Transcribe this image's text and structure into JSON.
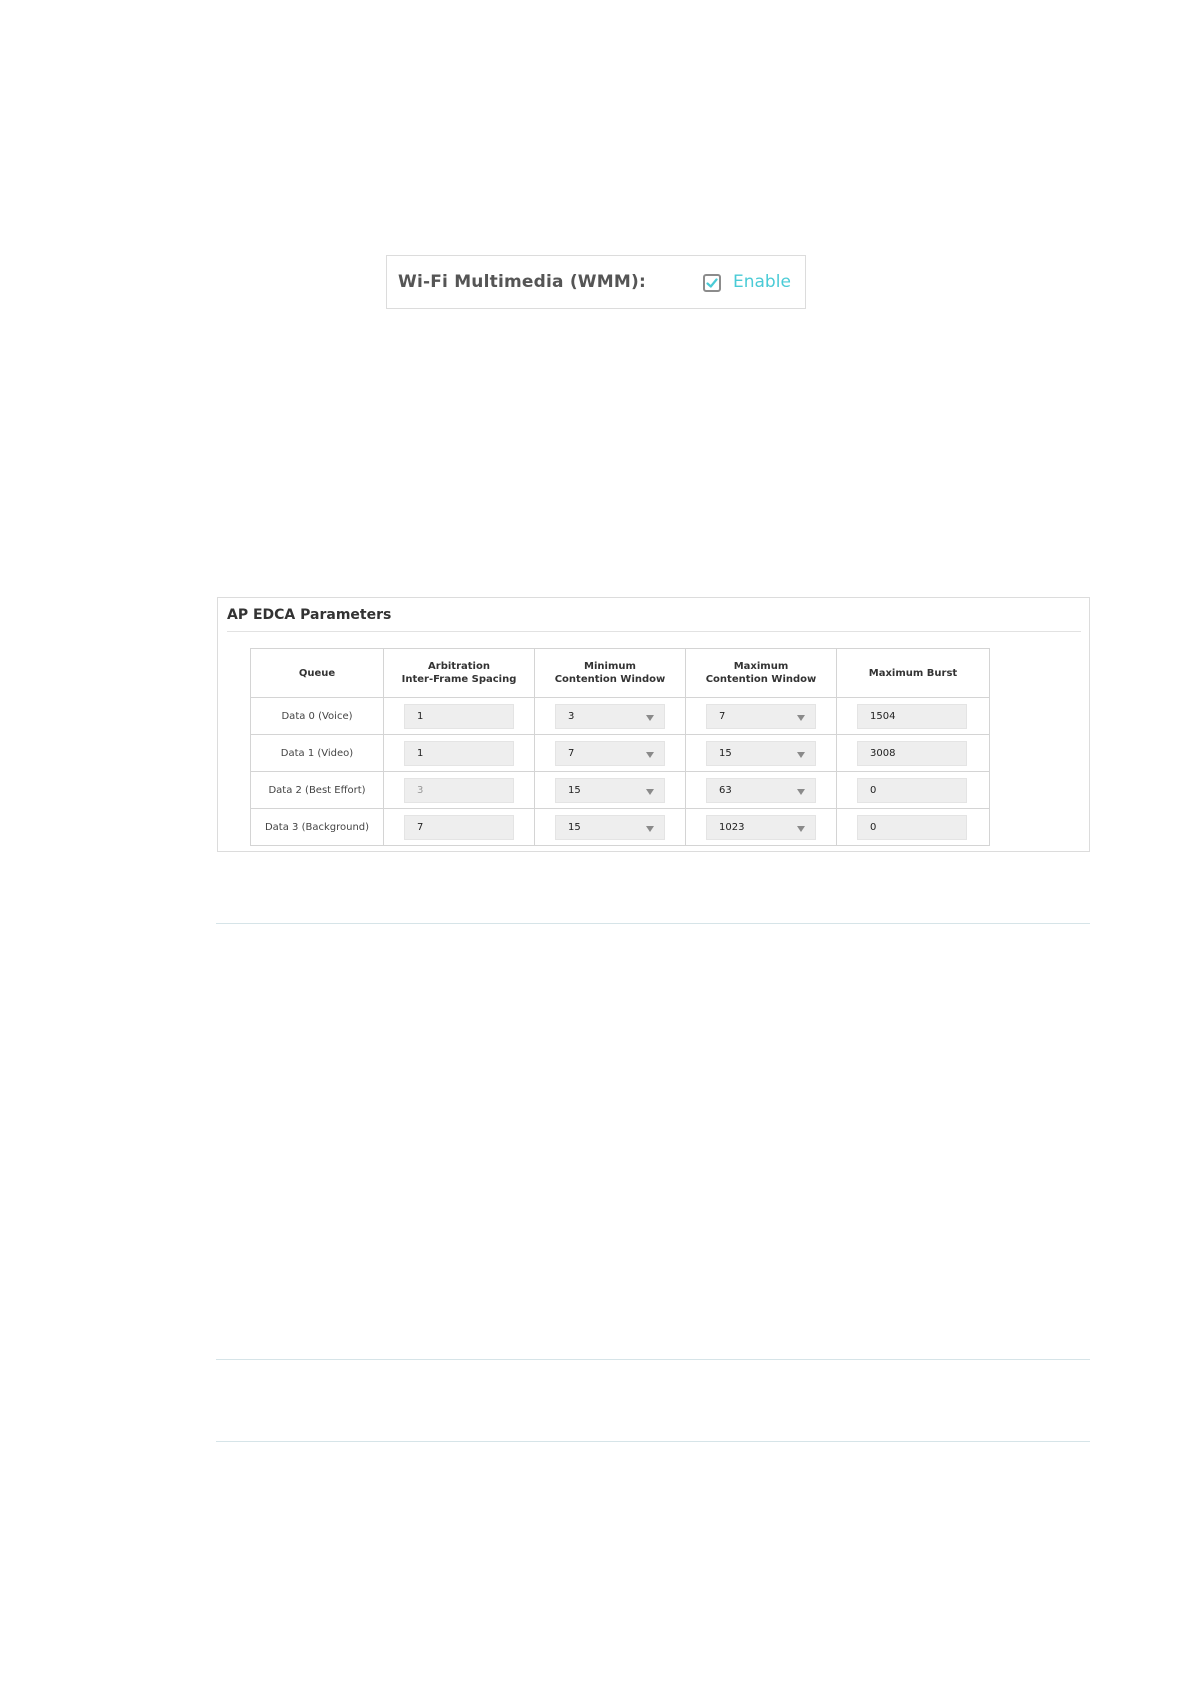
{
  "wmm": {
    "label": "Wi-Fi Multimedia (WMM):",
    "enable_label": "Enable",
    "checked": true,
    "accent_color": "#4acbd6"
  },
  "edca": {
    "title": "AP EDCA Parameters",
    "headers": {
      "queue": "Queue",
      "aifs_line1": "Arbitration",
      "aifs_line2": "Inter-Frame Spacing",
      "cwmin_line1": "Minimum",
      "cwmin_line2": "Contention Window",
      "cwmax_line1": "Maximum",
      "cwmax_line2": "Contention Window",
      "burst": "Maximum Burst"
    },
    "rows": [
      {
        "queue": "Data 0 (Voice)",
        "aifs": "1",
        "cwmin": "3",
        "cwmax": "7",
        "burst": "1504"
      },
      {
        "queue": "Data 1 (Video)",
        "aifs": "1",
        "cwmin": "7",
        "cwmax": "15",
        "burst": "3008"
      },
      {
        "queue": "Data 2 (Best Effort)",
        "aifs": "3",
        "cwmin": "15",
        "cwmax": "63",
        "burst": "0"
      },
      {
        "queue": "Data 3 (Background)",
        "aifs": "7",
        "cwmin": "15",
        "cwmax": "1023",
        "burst": "0"
      }
    ]
  }
}
